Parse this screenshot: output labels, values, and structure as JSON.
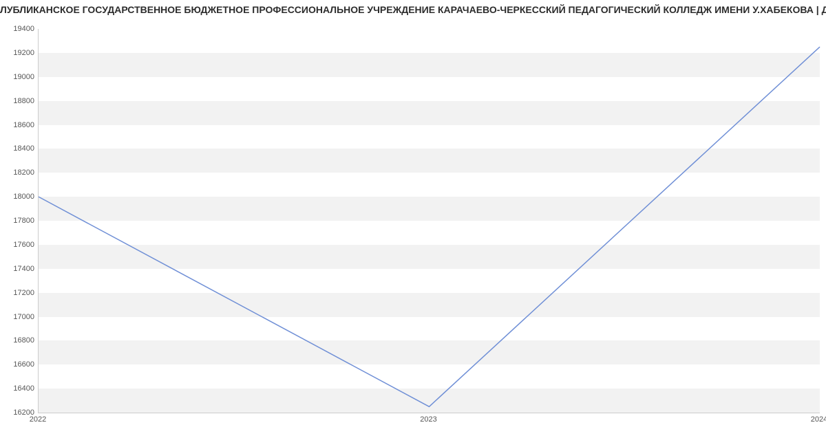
{
  "chart_data": {
    "type": "line",
    "title": "ЛУБЛИКАНСКОЕ ГОСУДАРСТВЕННОЕ БЮДЖЕТНОЕ ПРОФЕССИОНАЛЬНОЕ  УЧРЕЖДЕНИЕ КАРАЧАЕВО-ЧЕРКЕССКИЙ ПЕДАГОГИЧЕСКИЙ КОЛЛЕДЖ ИМЕНИ У.ХАБЕКОВА | Дан",
    "categories": [
      "2022",
      "2023",
      "2024"
    ],
    "values": [
      18000,
      16250,
      19250
    ],
    "xlabel": "",
    "ylabel": "",
    "ylim": [
      16200,
      19400
    ],
    "yticks": [
      16200,
      16400,
      16600,
      16800,
      17000,
      17200,
      17400,
      17600,
      17800,
      18000,
      18200,
      18400,
      18600,
      18800,
      19000,
      19200,
      19400
    ],
    "line_color": "#6f8fd6"
  }
}
